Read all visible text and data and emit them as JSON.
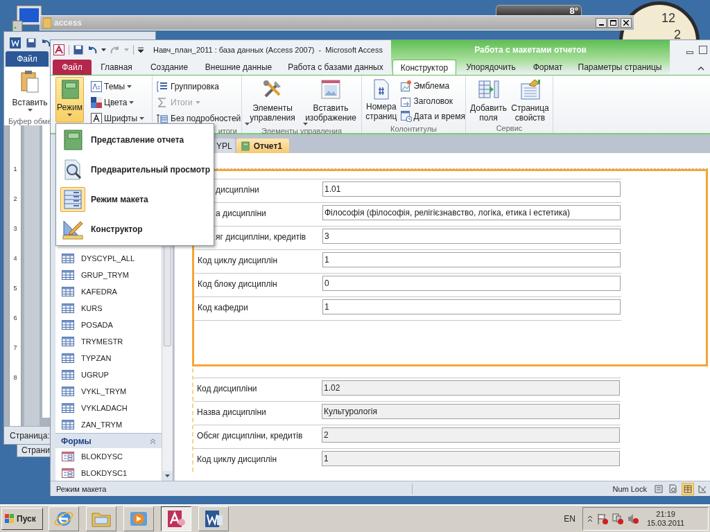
{
  "desktop": {
    "weather_temperature": "8°",
    "clock_numerals": [
      "12",
      "2"
    ]
  },
  "explorer_window": {
    "title": "access"
  },
  "word_window": {
    "file_tab": "Файл",
    "paste_button": "Вставить",
    "group_label": "Буфер обме",
    "ruler_numbers": [
      "1",
      "2",
      "3",
      "4",
      "5",
      "6",
      "7",
      "8"
    ],
    "status_text": "Страница:",
    "behind_status_text": "Страни"
  },
  "access_window": {
    "title": "Навч_план_2011 : база данных (Access 2007)  -  Microsoft Access",
    "contextual_header": "Работа с макетами отчетов",
    "tabs": [
      {
        "label": "Файл",
        "kind": "file",
        "selected": false
      },
      {
        "label": "Главная",
        "kind": "main",
        "selected": false
      },
      {
        "label": "Создание",
        "kind": "main",
        "selected": false
      },
      {
        "label": "Внешние данные",
        "kind": "main",
        "selected": false
      },
      {
        "label": "Работа с базами данных",
        "kind": "main",
        "selected": false
      },
      {
        "label": "Конструктор",
        "kind": "contextual",
        "selected": true
      },
      {
        "label": "Упорядочить",
        "kind": "contextual",
        "selected": false
      },
      {
        "label": "Формат",
        "kind": "contextual",
        "selected": false
      },
      {
        "label": "Параметры страницы",
        "kind": "contextual",
        "selected": false
      }
    ],
    "ribbon": {
      "mode_button": {
        "label": "Режим",
        "active": true
      },
      "theme_buttons": [
        {
          "label": "Темы",
          "kind": "themes"
        },
        {
          "label": "Цвета",
          "kind": "colors"
        },
        {
          "label": "Шрифты",
          "kind": "fonts"
        }
      ],
      "grouping": {
        "buttons": [
          {
            "label": "Группировка",
            "kind": "grouping",
            "disabled": false
          },
          {
            "label": "Итоги",
            "kind": "totals",
            "disabled": true
          },
          {
            "label": "Без подробностей",
            "kind": "details",
            "disabled": false
          }
        ],
        "group_label": "итоги"
      },
      "controls": {
        "buttons": [
          {
            "label": "Элементы управления",
            "kind": "tools"
          },
          {
            "label": "Вставить изображение",
            "kind": "image"
          }
        ],
        "group_label": "Элементы управления"
      },
      "header_footer": {
        "big_button": "Номера страниц",
        "buttons": [
          {
            "label": "Эмблема",
            "kind": "logo"
          },
          {
            "label": "Заголовок",
            "kind": "title"
          },
          {
            "label": "Дата и время",
            "kind": "datetime"
          }
        ],
        "group_label": "Колонтитулы"
      },
      "tools": {
        "buttons": [
          {
            "label": "Добавить поля",
            "kind": "fields"
          },
          {
            "label": "Страница свойств",
            "kind": "properties"
          }
        ],
        "group_label": "Сервис"
      }
    },
    "mode_menu": [
      {
        "label": "Представление отчета",
        "kind": "report",
        "selected": false
      },
      {
        "label": "Предварительный просмотр",
        "kind": "preview",
        "selected": false
      },
      {
        "label": "Режим макета",
        "kind": "layout",
        "selected": true
      },
      {
        "label": "Конструктор",
        "kind": "design",
        "selected": false
      }
    ],
    "navigation": {
      "tables": [
        "DYSCYPL_ALL",
        "GRUP_TRYM",
        "KAFEDRA",
        "KURS",
        "POSADA",
        "TRYMESTR",
        "TYPZAN",
        "UGRUP",
        "VYKL_TRYM",
        "VYKLADACH",
        "ZAN_TRYM"
      ],
      "forms_header": "Формы",
      "forms": [
        "BLOKDYSC",
        "BLOKDYSC1"
      ]
    },
    "document_tabs": [
      {
        "label": "YPL",
        "selected": false
      },
      {
        "label": "Отчет1",
        "selected": true
      }
    ],
    "records": [
      {
        "selected": true,
        "fields": [
          {
            "label": "дисципліни",
            "value": "1.01",
            "cut": true
          },
          {
            "label": "а дисципліни",
            "value": "Філософія (філософія, релігієзнавство, логіка, етика і естетика)",
            "cut": true
          },
          {
            "label": "яг дисципліни, кредитів",
            "value": "3",
            "cut": true
          },
          {
            "label": "Код циклу дисциплін",
            "value": "1",
            "cut": false
          },
          {
            "label": "Код блоку дисциплін",
            "value": "0",
            "cut": false
          },
          {
            "label": "Код кафедри",
            "value": "1",
            "cut": false
          }
        ]
      },
      {
        "selected": false,
        "fields": [
          {
            "label": "Код дисципліни",
            "value": "1.02",
            "cut": false
          },
          {
            "label": "Назва дисципліни",
            "value": "Культурологія",
            "cut": false
          },
          {
            "label": "Обсяг дисципліни, кредитів",
            "value": "2",
            "cut": false
          },
          {
            "label": "Код циклу дисциплін",
            "value": "1",
            "cut": false
          }
        ]
      }
    ],
    "status_bar": {
      "mode": "Режим макета",
      "num_lock": "Num Lock",
      "views": [
        {
          "kind": "report",
          "selected": false
        },
        {
          "kind": "preview",
          "selected": false
        },
        {
          "kind": "layout",
          "selected": true
        },
        {
          "kind": "design",
          "selected": false
        }
      ]
    }
  },
  "taskbar": {
    "start": "Пуск",
    "apps": [
      {
        "kind": "browser",
        "selected": false
      },
      {
        "kind": "folder",
        "selected": false
      },
      {
        "kind": "media",
        "selected": false
      },
      {
        "kind": "access",
        "selected": true
      },
      {
        "kind": "word",
        "selected": false
      }
    ],
    "language": "EN",
    "time": "21:19",
    "date": "15.03.2011"
  }
}
